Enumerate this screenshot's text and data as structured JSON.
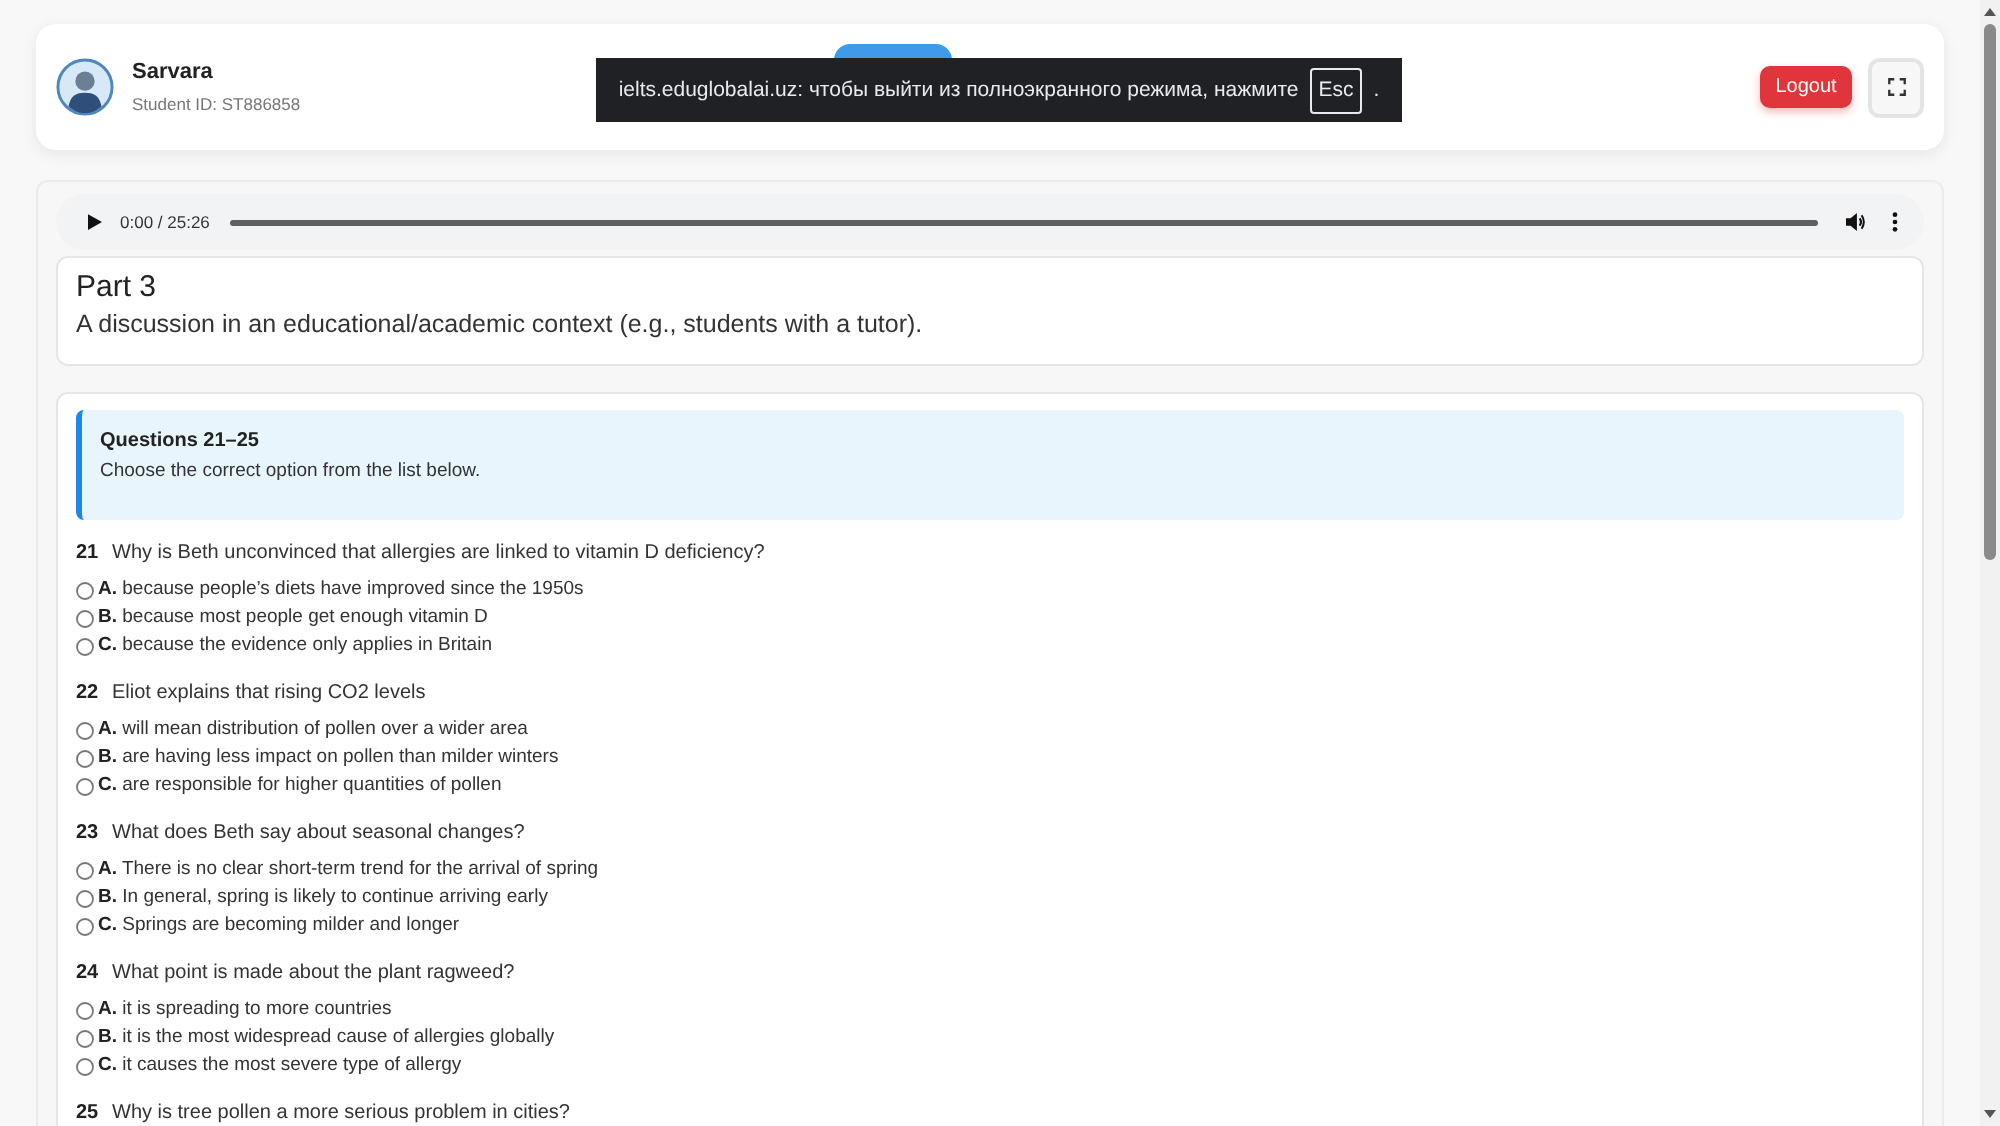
{
  "student": {
    "name": "Sarvara",
    "id_label": "Student ID: ST886858"
  },
  "header_actions": {
    "logout": "Logout"
  },
  "fullscreen_notice": {
    "text": "ielts.eduglobalai.uz: чтобы выйти из полноэкранного режима, нажмите",
    "key": "Esc",
    "suffix": "."
  },
  "audio_player": {
    "time": "0:00 / 25:26"
  },
  "part": {
    "title": "Part 3",
    "description": "A discussion in an educational/academic context (e.g., students with a tutor)."
  },
  "instructions": {
    "title": "Questions 21–25",
    "text": "Choose the correct option from the list below."
  },
  "questions": [
    {
      "number": "21",
      "text": "Why is Beth unconvinced that allergies are linked to vitamin D deficiency?",
      "options": [
        {
          "label": "**A.** because people’s diets have improved since the 1950s",
          "selected": false
        },
        {
          "label": "**B.** because most people get enough vitamin D",
          "selected": false
        },
        {
          "label": "**C.** because the evidence only applies in Britain",
          "selected": false
        }
      ]
    },
    {
      "number": "22",
      "text": "Eliot explains that rising CO2 levels",
      "options": [
        {
          "label": "**A.** will mean distribution of pollen over a wider area",
          "selected": false
        },
        {
          "label": "**B.** are having less impact on pollen than milder winters",
          "selected": false
        },
        {
          "label": "**C.** are responsible for higher quantities of pollen",
          "selected": false
        }
      ]
    },
    {
      "number": "23",
      "text": "What does Beth say about seasonal changes?",
      "options": [
        {
          "label": "**A.** There is no clear short-term trend for the arrival of spring",
          "selected": false
        },
        {
          "label": "**B.** In general, spring is likely to continue arriving early",
          "selected": false
        },
        {
          "label": "**C.** Springs are becoming milder and longer",
          "selected": false
        }
      ]
    },
    {
      "number": "24",
      "text": "What point is made about the plant ragweed?",
      "options": [
        {
          "label": "**A.** it is spreading to more countries",
          "selected": false
        },
        {
          "label": "**B.** it is the most widespread cause of allergies globally",
          "selected": false
        },
        {
          "label": "**C.** it causes the most severe type of allergy",
          "selected": false
        }
      ]
    },
    {
      "number": "25",
      "text": "Why is tree pollen a more serious problem in cities?"
    }
  ]
}
